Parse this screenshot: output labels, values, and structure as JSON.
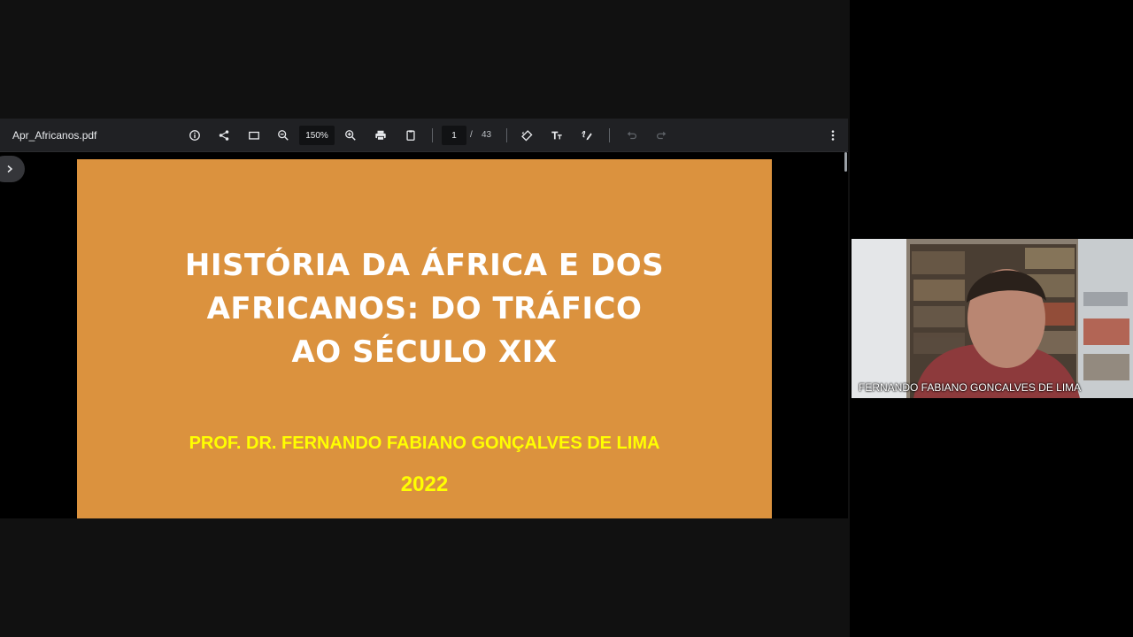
{
  "pdf_viewer": {
    "file_name": "Apr_Africanos.pdf",
    "zoom": "150%",
    "page_current": "1",
    "page_separator": "/",
    "page_total": "43"
  },
  "slide": {
    "title": "HISTÓRIA DA ÁFRICA E DOS\nAFRICANOS: DO TRÁFICO\nAO SÉCULO XIX",
    "author": "PROF. DR. FERNANDO FABIANO GONÇALVES DE LIMA",
    "year": "2022"
  },
  "participant": {
    "name": "FERNANDO FABIANO GONCALVES DE LIMA"
  },
  "colors": {
    "slide_background": "#db923e",
    "slide_title": "#ffffff",
    "slide_subtitle": "#ffff00",
    "toolbar": "#202124"
  }
}
